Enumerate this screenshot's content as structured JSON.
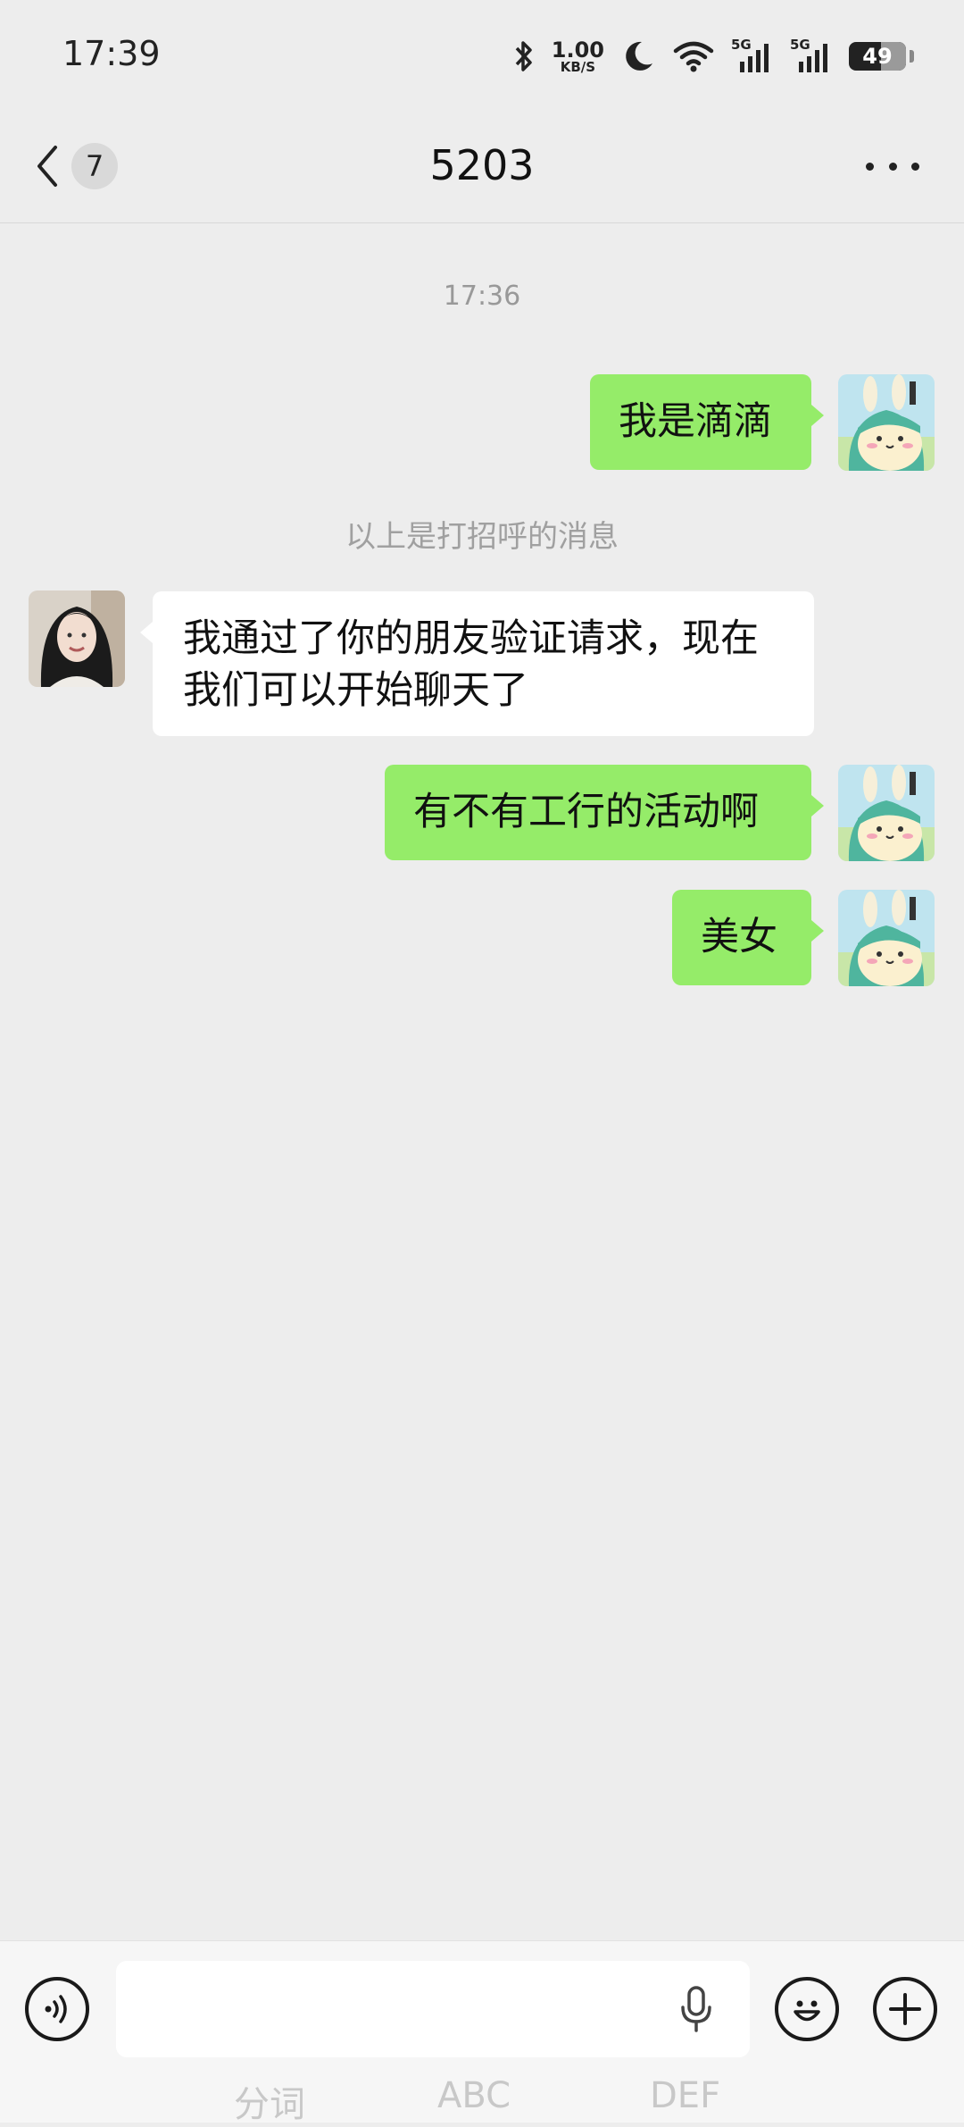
{
  "status_bar": {
    "time": "17:39",
    "net_speed_value": "1.00",
    "net_speed_unit": "KB/S",
    "battery": "49",
    "signal_1_label": "5G",
    "signal_2_label": "5G"
  },
  "header": {
    "unread_count": "7",
    "title": "5203"
  },
  "chat": {
    "timestamp": "17:36",
    "system_notice": "以上是打招呼的消息",
    "messages": [
      {
        "direction": "out",
        "text": "我是滴滴"
      },
      {
        "direction": "in",
        "text": "我通过了你的朋友验证请求，现在我们可以开始聊天了"
      },
      {
        "direction": "out",
        "text": "有不有工行的活动啊"
      },
      {
        "direction": "out",
        "text": "美女"
      }
    ]
  },
  "input_bar": {
    "value": "",
    "keyboard_hint_1": "分词",
    "keyboard_hint_2": "ABC",
    "keyboard_hint_3": "DEF"
  },
  "colors": {
    "outgoing_bubble": "#95ec69",
    "incoming_bubble": "#ffffff",
    "background": "#ededed"
  }
}
